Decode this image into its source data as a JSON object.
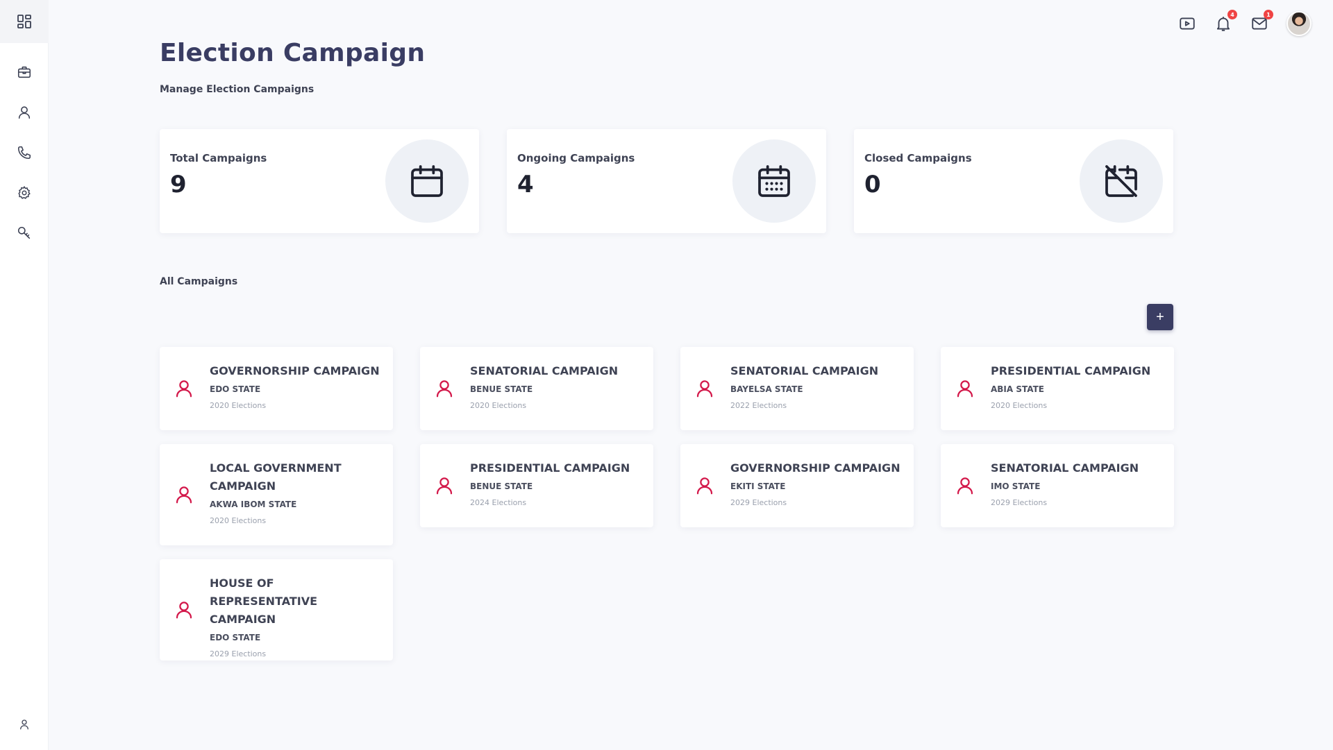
{
  "header": {
    "title": "Election Campaign",
    "subtitle": "Manage Election Campaigns"
  },
  "topbar": {
    "notification_count": "4",
    "mail_count": "1"
  },
  "stats": [
    {
      "label": "Total Campaigns",
      "value": "9",
      "icon": "calendar-icon"
    },
    {
      "label": "Ongoing Campaigns",
      "value": "4",
      "icon": "calendar-grid-icon"
    },
    {
      "label": "Closed Campaigns",
      "value": "0",
      "icon": "calendar-off-icon"
    }
  ],
  "section": {
    "title": "All Campaigns",
    "add_label": "+"
  },
  "campaigns": [
    {
      "name": "GOVERNORSHIP CAMPAIGN",
      "state": "EDO STATE",
      "year": "2020 Elections"
    },
    {
      "name": "SENATORIAL CAMPAIGN",
      "state": "BENUE STATE",
      "year": "2020 Elections"
    },
    {
      "name": "SENATORIAL CAMPAIGN",
      "state": "BAYELSA STATE",
      "year": "2022 Elections"
    },
    {
      "name": "PRESIDENTIAL CAMPAIGN",
      "state": "ABIA STATE",
      "year": "2020 Elections"
    },
    {
      "name": "LOCAL GOVERNMENT CAMPAIGN",
      "state": "AKWA IBOM STATE",
      "year": "2020 Elections"
    },
    {
      "name": "PRESIDENTIAL CAMPAIGN",
      "state": "BENUE STATE",
      "year": "2024 Elections"
    },
    {
      "name": "GOVERNORSHIP CAMPAIGN",
      "state": "EKITI STATE",
      "year": "2029 Elections"
    },
    {
      "name": "SENATORIAL CAMPAIGN",
      "state": "IMO STATE",
      "year": "2029 Elections"
    },
    {
      "name": "HOUSE OF REPRESENTATIVE CAMPAIGN",
      "state": "EDO STATE",
      "year": "2029 Elections"
    }
  ],
  "icons": {
    "sidebar": [
      "dashboard-icon",
      "briefcase-icon",
      "user-icon",
      "phone-icon",
      "settings-icon",
      "key-icon",
      "profile-icon"
    ],
    "topbar": [
      "video-icon",
      "bell-icon",
      "mail-icon",
      "avatar"
    ]
  },
  "colors": {
    "accent": "#3a3d63",
    "campaign_icon": "#d3184a",
    "badge": "#ef4444",
    "background": "#f8f9fc"
  }
}
